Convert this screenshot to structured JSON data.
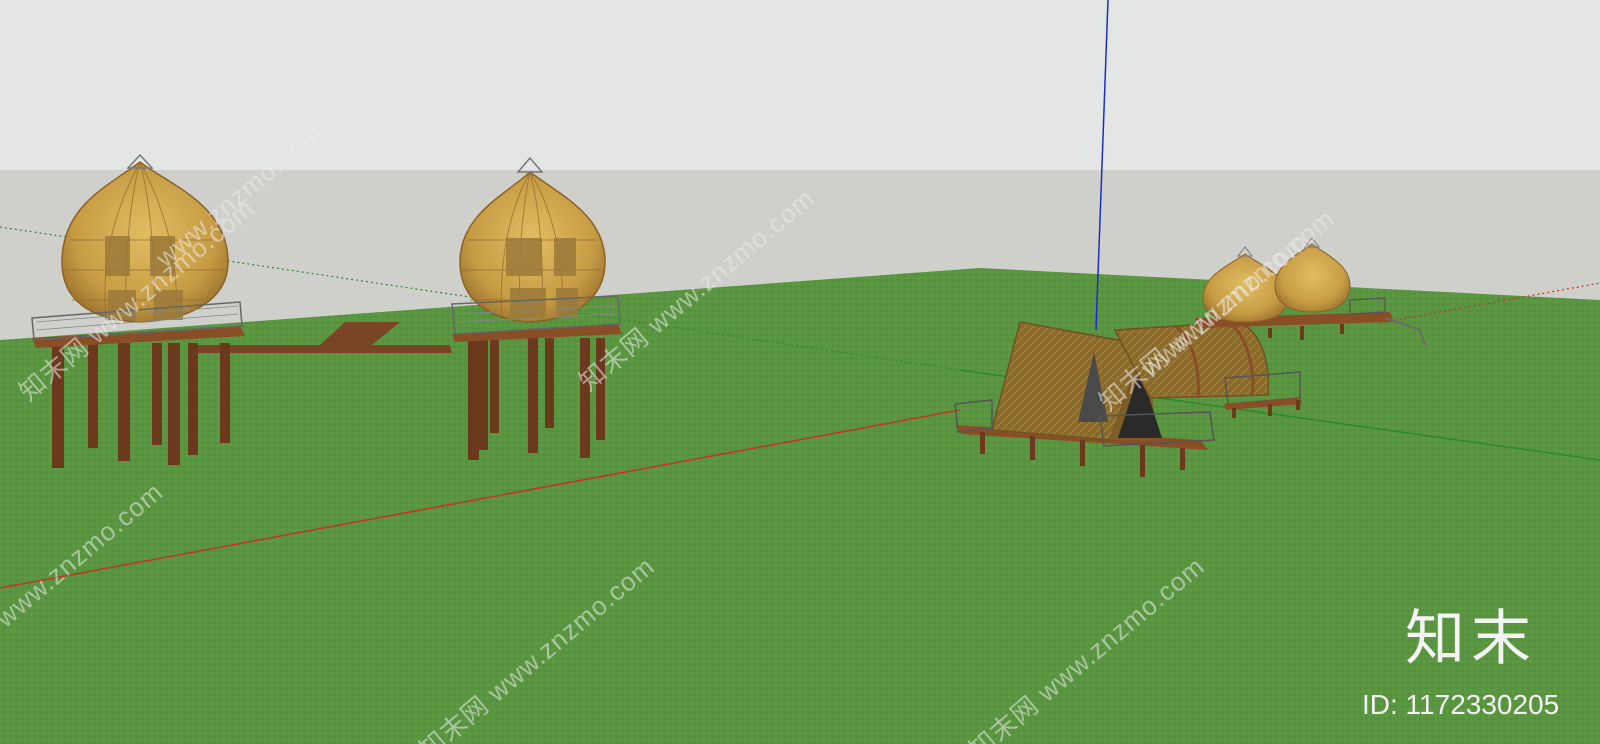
{
  "watermark": {
    "wm1": "知末网 www.znzmo.com",
    "wm2": "www.znzmo.com",
    "wm3": "知末网 www.znzmo.com",
    "wm4": "www.znzmo.com",
    "wm5": "www.znzmo.com",
    "wm6": "知末网 www.znzmo.com",
    "wm7": "知末网 www.znzmo.com",
    "wm8": "知末网 www.znzmo.com"
  },
  "brand": {
    "logo": "知末",
    "id_text": "ID: 1172330205"
  },
  "colors": {
    "sky": "#e4e6e5",
    "backdrop": "#cfcfcb",
    "ground": "#5a9541",
    "axis_red": "#c8321e",
    "axis_green": "#2a8a2a",
    "axis_blue": "#1c2fc4",
    "wood": "#6b3a1c",
    "rattan": "#c9a24e"
  }
}
